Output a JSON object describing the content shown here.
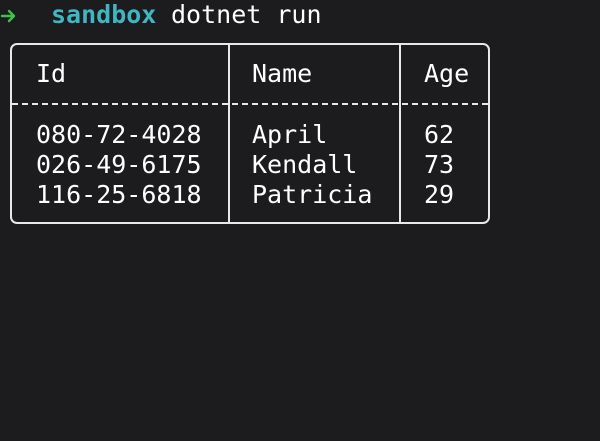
{
  "prompt": {
    "arrow_icon": "arrow-right-icon",
    "arrow_color": "#3fc24a",
    "directory": "sandbox",
    "command": "dotnet run"
  },
  "table": {
    "columns": [
      "Id",
      "Name",
      "Age"
    ],
    "rows": [
      [
        "080-72-4028",
        "April",
        "62"
      ],
      [
        "026-49-6175",
        "Kendall",
        "73"
      ],
      [
        "116-25-6818",
        "Patricia",
        "29"
      ]
    ]
  },
  "colors": {
    "background": "#1c1b1e",
    "directory": "#3fb6c0",
    "text": "#ffffff",
    "border": "#e8e8e8"
  }
}
